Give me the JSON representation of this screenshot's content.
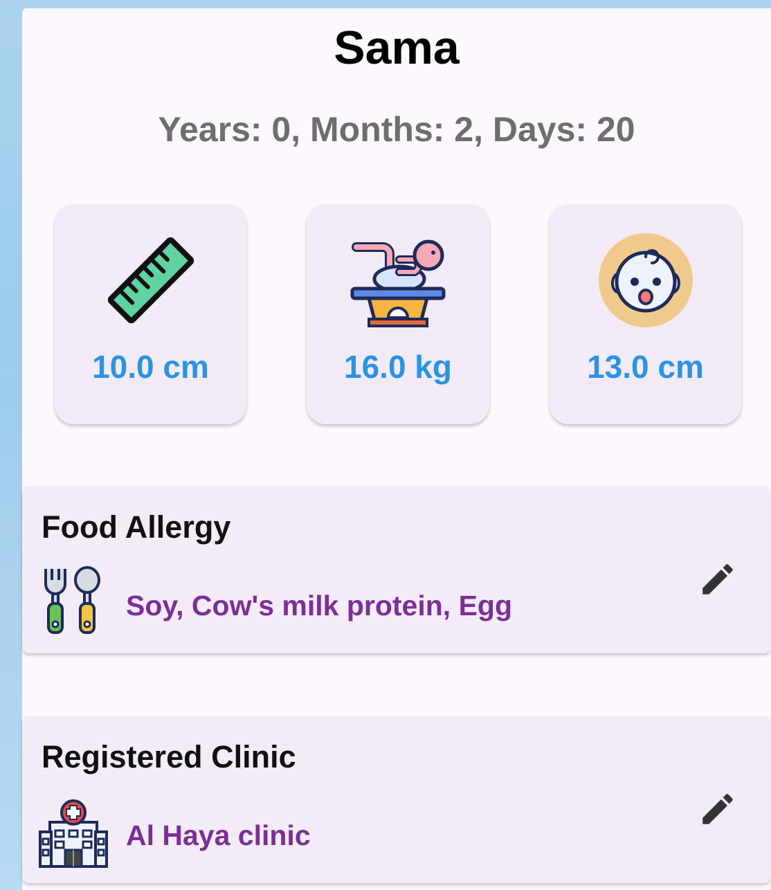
{
  "child": {
    "name": "Sama",
    "age": "Years: 0, Months: 2, Days: 20"
  },
  "stats": [
    {
      "icon": "ruler-icon",
      "value": "10.0 cm"
    },
    {
      "icon": "baby-scale-icon",
      "value": "16.0 kg"
    },
    {
      "icon": "baby-face-icon",
      "value": "13.0 cm"
    }
  ],
  "food_allergy": {
    "title": "Food Allergy",
    "value": "Soy, Cow's milk protein, Egg",
    "icon": "fork-spoon-icon",
    "edit_icon": "pencil-icon"
  },
  "clinic": {
    "title": "Registered Clinic",
    "value": "Al Haya clinic",
    "icon": "hospital-icon",
    "edit_icon": "pencil-icon"
  },
  "colors": {
    "stat_value": "#2a93e6",
    "card_value": "#7b2f96",
    "age_text": "#6e6e6e",
    "card_bg": "#f3ecf7"
  }
}
